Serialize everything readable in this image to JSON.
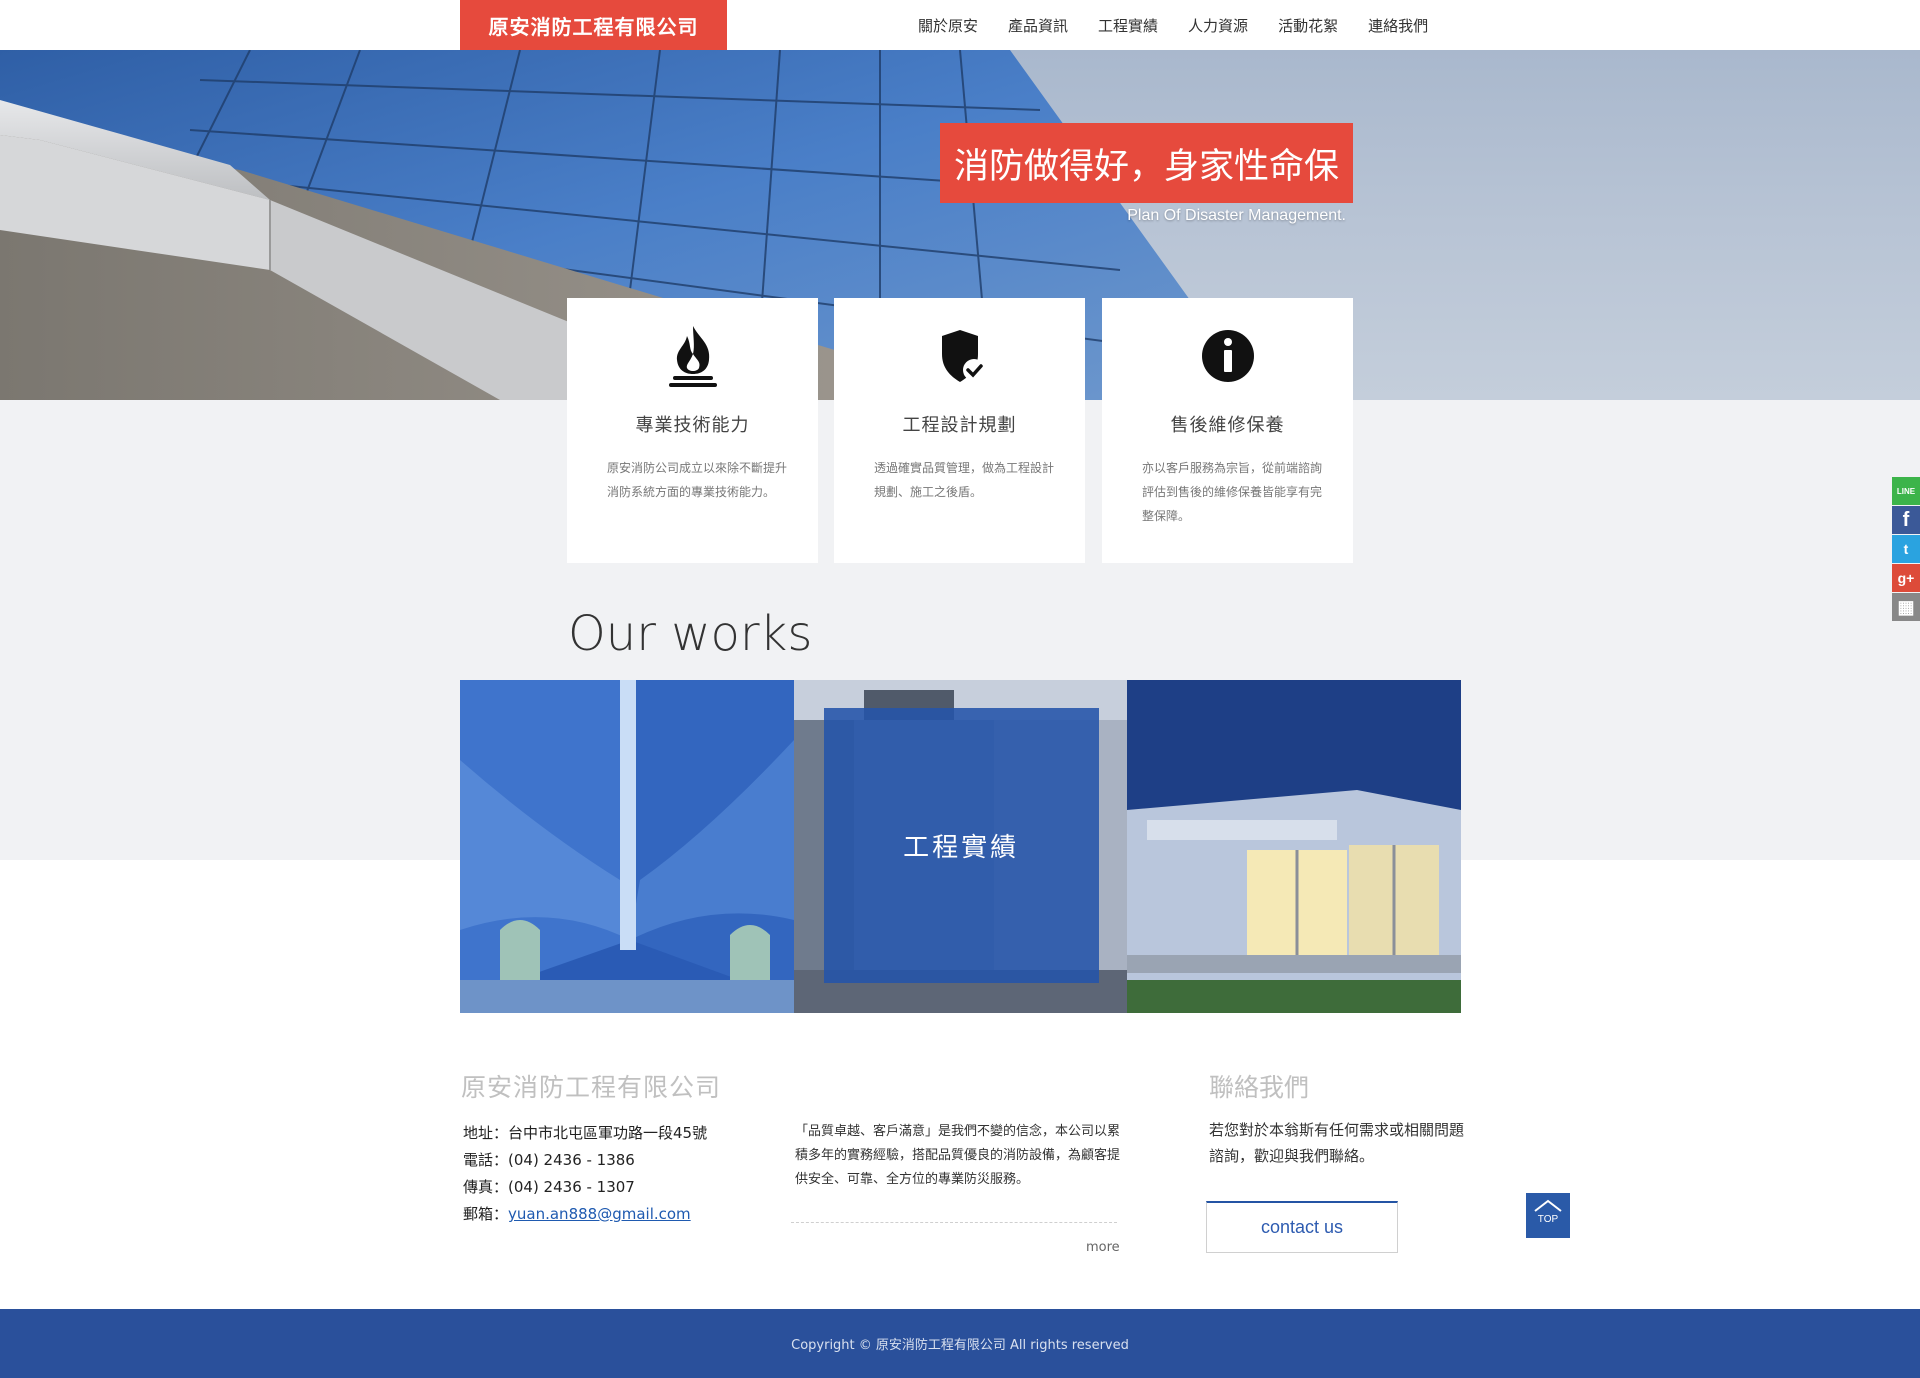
{
  "header": {
    "logo": "原安消防工程有限公司",
    "nav": [
      "關於原安",
      "產品資訊",
      "工程實績",
      "人力資源",
      "活動花絮",
      "連絡我們"
    ]
  },
  "hero": {
    "title": "消防做得好，身家性命保",
    "subtitle": "Plan Of Disaster Management."
  },
  "features": [
    {
      "icon": "fire-icon",
      "title": "專業技術能力",
      "text": "原安消防公司成立以來除不斷提升消防系統方面的專業技術能力。"
    },
    {
      "icon": "shield-check-icon",
      "title": "工程設計規劃",
      "text": "透過確實品質管理，做為工程設計規劃、施工之後盾。"
    },
    {
      "icon": "info-icon",
      "title": "售後維修保養",
      "text": "亦以客戶服務為宗旨，從前端諮詢評估到售後的維修保養皆能享有完整保障。"
    }
  ],
  "works": {
    "title": "Our works",
    "overlay_label": "工程實績"
  },
  "footer": {
    "company_name": "原安消防工程有限公司",
    "address": "地址：台中市北屯區軍功路一段45號",
    "phone": "電話：(04) 2436 - 1386",
    "fax": "傳真：(04) 2436 - 1307",
    "email_label": "郵箱：",
    "email": "yuan.an888@gmail.com",
    "about": "「品質卓越、客戶滿意」是我們不變的信念，本公司以累積多年的實務經驗，搭配品質優良的消防設備，為顧客提供安全、可靠、全方位的專業防災服務。",
    "more": "more",
    "contact_title": "聯絡我們",
    "contact_text": "若您對於本翁斯有任何需求或相關問題諮詢，歡迎與我們聯絡。",
    "contact_button": "contact us",
    "top_label": "TOP",
    "copyright": "Copyright © 原安消防工程有限公司  All rights reserved"
  },
  "social": [
    {
      "name": "line-icon",
      "label": "LINE",
      "color": "#3cb44a"
    },
    {
      "name": "facebook-icon",
      "label": "f",
      "color": "#3b5998"
    },
    {
      "name": "twitter-icon",
      "label": "t",
      "color": "#2aa3e0"
    },
    {
      "name": "google-plus-icon",
      "label": "g+",
      "color": "#dd4b39"
    },
    {
      "name": "qrcode-icon",
      "label": "▦",
      "color": "#888888"
    }
  ],
  "colors": {
    "brand_red": "#e64a3d",
    "brand_blue": "#2a509b"
  }
}
